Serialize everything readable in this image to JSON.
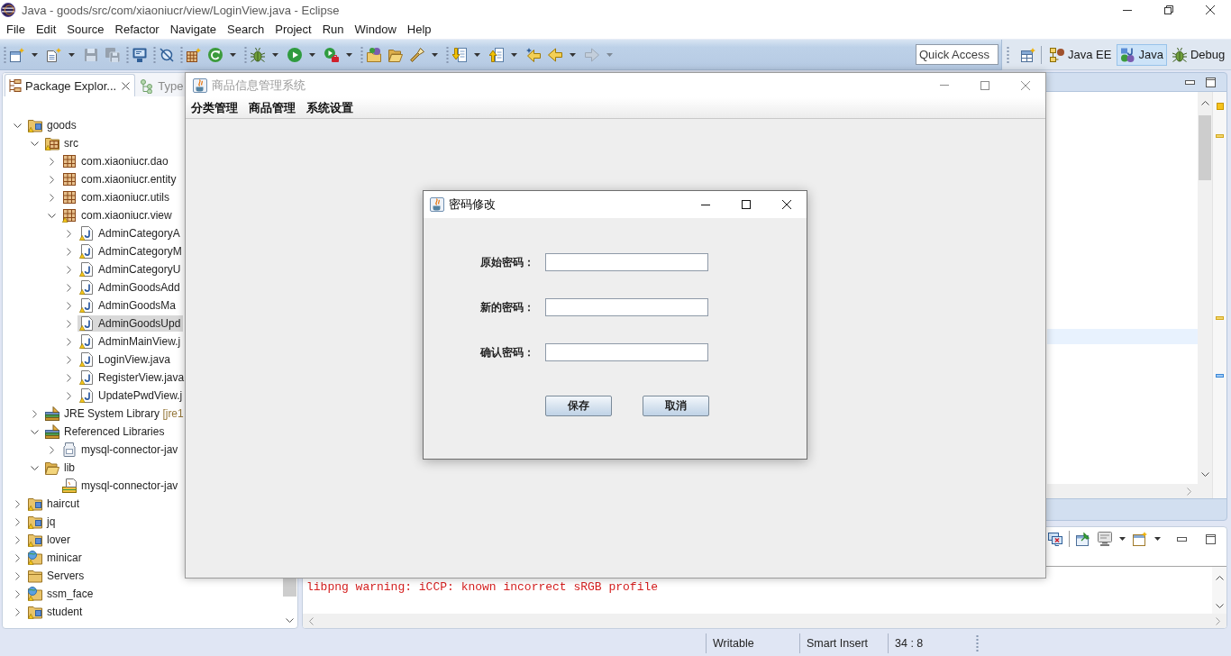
{
  "ide_window": {
    "title": "Java - goods/src/com/xiaoniucr/view/LoginView.java - Eclipse"
  },
  "menu_bar": [
    "File",
    "Edit",
    "Source",
    "Refactor",
    "Navigate",
    "Search",
    "Project",
    "Run",
    "Window",
    "Help"
  ],
  "toolbar": {
    "groups": [
      [
        {
          "kind": "new",
          "dropdown": true,
          "disabled": false
        },
        {
          "kind": "newfile",
          "dropdown": true,
          "disabled": false
        },
        {
          "kind": "save",
          "dropdown": false,
          "disabled": true
        },
        {
          "kind": "saveall",
          "dropdown": false,
          "disabled": true
        }
      ],
      [
        {
          "kind": "monitor",
          "dropdown": false,
          "disabled": false
        }
      ],
      [
        {
          "kind": "skip",
          "dropdown": false,
          "disabled": false
        }
      ],
      [
        {
          "kind": "package",
          "dropdown": false,
          "disabled": false
        },
        {
          "kind": "coverage",
          "dropdown": true,
          "disabled": false
        }
      ],
      [
        {
          "kind": "debug",
          "dropdown": true,
          "disabled": false
        },
        {
          "kind": "run",
          "dropdown": true,
          "disabled": false
        },
        {
          "kind": "external",
          "dropdown": true,
          "disabled": false
        }
      ],
      [
        {
          "kind": "opentype",
          "dropdown": false,
          "disabled": false
        },
        {
          "kind": "openfolder",
          "dropdown": false,
          "disabled": false
        },
        {
          "kind": "search",
          "dropdown": true,
          "disabled": false
        }
      ],
      [
        {
          "kind": "nextannotation",
          "dropdown": true,
          "disabled": false
        },
        {
          "kind": "prevannotation",
          "dropdown": true,
          "disabled": false
        },
        {
          "kind": "lastedit",
          "dropdown": false,
          "disabled": false
        },
        {
          "kind": "back",
          "dropdown": true,
          "disabled": false
        },
        {
          "kind": "forward",
          "dropdown": true,
          "disabled": true
        }
      ]
    ],
    "quick_access": {
      "placeholder": "Quick Access"
    }
  },
  "perspectives": [
    {
      "kind": "javaee",
      "label": "Java EE",
      "selected": false
    },
    {
      "kind": "java",
      "label": "Java",
      "selected": true
    },
    {
      "kind": "debug",
      "label": "Debug",
      "selected": false
    }
  ],
  "package_explorer": {
    "tabs": [
      {
        "kind": "packages",
        "label": "Package Explor...",
        "selected": true
      },
      {
        "kind": "hierarchy",
        "label": "Type",
        "selected": false
      }
    ],
    "tree": [
      {
        "kind": "project",
        "label": "goods",
        "warning": true,
        "expanded": true,
        "selected": false,
        "children": [
          {
            "kind": "srcfolder",
            "label": "src",
            "warning": true,
            "expanded": true,
            "selected": false,
            "children": [
              {
                "kind": "package",
                "label": "com.xiaoniucr.dao",
                "warning": false,
                "expanded": false,
                "selected": false
              },
              {
                "kind": "package",
                "label": "com.xiaoniucr.entity",
                "warning": false,
                "expanded": false,
                "selected": false
              },
              {
                "kind": "package",
                "label": "com.xiaoniucr.utils",
                "warning": false,
                "expanded": false,
                "selected": false
              },
              {
                "kind": "package",
                "label": "com.xiaoniucr.view",
                "warning": true,
                "expanded": true,
                "selected": false,
                "children": [
                  {
                    "kind": "java",
                    "label": "AdminCategoryA",
                    "warning": true,
                    "expanded": false,
                    "selected": false
                  },
                  {
                    "kind": "java",
                    "label": "AdminCategoryM",
                    "warning": true,
                    "expanded": false,
                    "selected": false
                  },
                  {
                    "kind": "java",
                    "label": "AdminCategoryU",
                    "warning": true,
                    "expanded": false,
                    "selected": false
                  },
                  {
                    "kind": "java",
                    "label": "AdminGoodsAdd",
                    "warning": true,
                    "expanded": false,
                    "selected": false
                  },
                  {
                    "kind": "java",
                    "label": "AdminGoodsMa",
                    "warning": true,
                    "expanded": false,
                    "selected": false
                  },
                  {
                    "kind": "java",
                    "label": "AdminGoodsUpd",
                    "warning": true,
                    "expanded": false,
                    "selected": true
                  },
                  {
                    "kind": "java",
                    "label": "AdminMainView.j",
                    "warning": true,
                    "expanded": false,
                    "selected": false
                  },
                  {
                    "kind": "java",
                    "label": "LoginView.java",
                    "warning": true,
                    "expanded": false,
                    "selected": false
                  },
                  {
                    "kind": "java",
                    "label": "RegisterView.java",
                    "warning": true,
                    "expanded": false,
                    "selected": false
                  },
                  {
                    "kind": "java",
                    "label": "UpdatePwdView.j",
                    "warning": true,
                    "expanded": false,
                    "selected": false
                  }
                ]
              }
            ]
          },
          {
            "kind": "library",
            "label": "JRE System Library",
            "decoration": "[jre1",
            "warning": false,
            "expanded": false,
            "selected": false
          },
          {
            "kind": "library",
            "label": "Referenced Libraries",
            "warning": false,
            "expanded": true,
            "selected": false,
            "children": [
              {
                "kind": "jar",
                "label": "mysql-connector-jav",
                "warning": false,
                "expanded": false,
                "selected": false
              }
            ]
          },
          {
            "kind": "folder",
            "label": "lib",
            "warning": false,
            "expanded": true,
            "selected": false,
            "children": [
              {
                "kind": "jarfile",
                "label": "mysql-connector-jav",
                "warning": false,
                "selected": false
              }
            ]
          }
        ]
      },
      {
        "kind": "project",
        "label": "haircut",
        "warning": true,
        "expanded": false,
        "selected": false
      },
      {
        "kind": "project",
        "label": "jq",
        "warning": true,
        "expanded": false,
        "selected": false
      },
      {
        "kind": "project",
        "label": "lover",
        "warning": true,
        "expanded": false,
        "selected": false
      },
      {
        "kind": "webproject",
        "label": "minicar",
        "warning": true,
        "expanded": false,
        "selected": false
      },
      {
        "kind": "folder",
        "label": "Servers",
        "warning": false,
        "expanded": false,
        "selected": false
      },
      {
        "kind": "webproject",
        "label": "ssm_face",
        "warning": true,
        "expanded": false,
        "selected": false
      },
      {
        "kind": "project",
        "label": "student",
        "warning": true,
        "expanded": false,
        "selected": false
      }
    ]
  },
  "console": {
    "lines": [
      "libpng warning: iCCP: known incorrect sRGB profile"
    ]
  },
  "status_bar": {
    "fields": [
      "Writable",
      "Smart Insert",
      "34 : 8"
    ]
  },
  "app_window": {
    "title": "商品信息管理系统",
    "active": false,
    "menu": [
      "分类管理",
      "商品管理",
      "系统设置"
    ]
  },
  "dialog": {
    "title": "密码修改",
    "active": true,
    "fields": [
      {
        "label": "原始密码："
      },
      {
        "label": "新的密码："
      },
      {
        "label": "确认密码："
      }
    ],
    "buttons": [
      "保存",
      "取消"
    ]
  }
}
